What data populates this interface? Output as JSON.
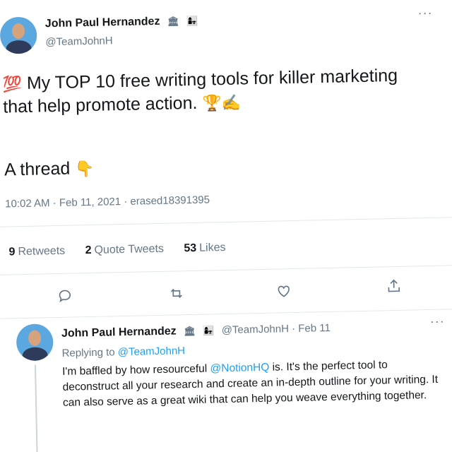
{
  "tweet": {
    "author_name": "John Paul Hernandez",
    "author_badges": [
      "🏛",
      "👩‍👧"
    ],
    "author_handle": "@TeamJohnH",
    "emoji_prefix": "💯",
    "text_line1": "My TOP 10 free writing tools for killer marketing",
    "text_line2": "that help promote action.",
    "text_emojis": "🏆✍",
    "thread_text": "A thread",
    "thread_emoji": "👇",
    "timestamp": "10:02 AM · Feb 11, 2021 · erased18391395",
    "stats": {
      "retweets_count": "9",
      "retweets_label": "Retweets",
      "quotes_count": "2",
      "quotes_label": "Quote Tweets",
      "likes_count": "53",
      "likes_label": "Likes"
    },
    "actions": [
      "reply-icon",
      "retweet-icon",
      "like-icon",
      "share-icon"
    ]
  },
  "reply": {
    "author_name": "John Paul Hernandez",
    "author_badges": [
      "🏛",
      "👩‍👧"
    ],
    "handle_date": "@TeamJohnH · Feb 11",
    "replying_label": "Replying to",
    "replying_handle": "@TeamJohnH",
    "text_part1": "I'm baffled by how resourceful",
    "mention": "@NotionHQ",
    "text_part2": "is. It's the perfect tool to deconstruct all your research and create an in-depth outline for your writing. It can also serve as a great wiki that can help you weave everything together."
  },
  "colors": {
    "accent": "#1da1f2",
    "muted": "#657786",
    "divider": "#e1e8ed"
  }
}
